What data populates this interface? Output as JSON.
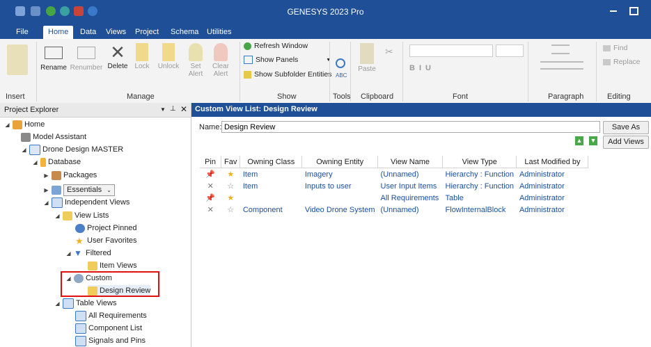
{
  "window": {
    "title": "GENESYS 2023 Pro"
  },
  "ribbon_tabs": [
    "File",
    "Home",
    "Data",
    "Views",
    "Project",
    "Schema",
    "Utilities"
  ],
  "ribbon": {
    "groups": [
      "Insert",
      "Manage",
      "Show",
      "Tools",
      "Clipboard",
      "Font",
      "Paragraph",
      "Editing"
    ],
    "manage_buttons": [
      "Rename",
      "Renumber",
      "Delete",
      "Lock",
      "Unlock",
      "Set Alert",
      "Clear Alert"
    ],
    "show_items": [
      "Refresh Window",
      "Show Panels",
      "Show Subfolder Entities"
    ],
    "clipboard_paste": "Paste",
    "editing": [
      "Find",
      "Replace"
    ]
  },
  "explorer": {
    "title": "Project Explorer",
    "tree": [
      {
        "label": "Home"
      },
      {
        "label": "Model Assistant"
      },
      {
        "label": "Drone Design MASTER"
      },
      {
        "label": "Database"
      },
      {
        "label": "Packages"
      },
      {
        "label": "Essentials"
      },
      {
        "label": "Independent Views"
      },
      {
        "label": "View Lists"
      },
      {
        "label": "Project Pinned"
      },
      {
        "label": "User Favorites"
      },
      {
        "label": "Filtered"
      },
      {
        "label": "Item Views"
      },
      {
        "label": "Custom"
      },
      {
        "label": "Design Review"
      },
      {
        "label": "Table Views"
      },
      {
        "label": "All Requirements"
      },
      {
        "label": "Component List"
      },
      {
        "label": "Signals and Pins"
      }
    ]
  },
  "view": {
    "title": "Custom View List: Design Review",
    "name_label": "Name:",
    "name_value": "Design Review",
    "save_as": "Save As",
    "add_views": "Add Views",
    "columns": [
      "Pin",
      "Fav",
      "Owning Class",
      "Owning Entity",
      "View Name",
      "View Type",
      "Last Modified by"
    ],
    "rows": [
      {
        "pinned": true,
        "fav": true,
        "owning_class": "Item",
        "owning_entity": "Imagery",
        "view_name": "(Unnamed)",
        "view_type": "Hierarchy : Function",
        "modified_by": "Administrator"
      },
      {
        "pinned": false,
        "fav": false,
        "owning_class": "Item",
        "owning_entity": "Inputs to user",
        "view_name": "User Input Items",
        "view_type": "Hierarchy : Function",
        "modified_by": "Administrator"
      },
      {
        "pinned": true,
        "fav": true,
        "owning_class": "",
        "owning_entity": "",
        "view_name": "All Requirements",
        "view_type": "Table",
        "modified_by": "Administrator"
      },
      {
        "pinned": false,
        "fav": false,
        "owning_class": "Component",
        "owning_entity": "Video Drone System",
        "view_name": "(Unnamed)",
        "view_type": "FlowInternalBlock",
        "modified_by": "Administrator"
      }
    ]
  }
}
